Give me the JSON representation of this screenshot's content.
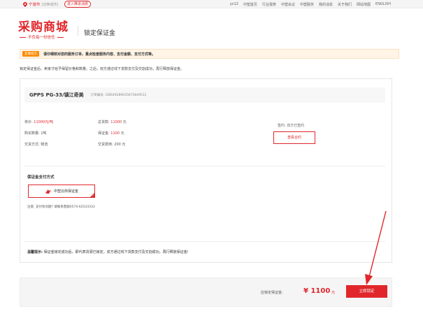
{
  "topbar": {
    "city": "宁波市",
    "switch_city": "[切换城市]",
    "login_label": "进入推进消费",
    "nav": [
      "yc12",
      "中塑首页",
      "行业报表",
      "中塑会议",
      "中塑服务",
      "我的消息",
      "关于我们",
      "网站地图",
      "ENGLISH"
    ]
  },
  "header": {
    "logo_main": "采购商城",
    "logo_sub": "不负每一份信任",
    "page_title": "锁定保证金"
  },
  "notice": {
    "tag": "友情提示",
    "text": "请仔细核对您的服务订单，重点检查服务内容、支付金额、支付方式等。"
  },
  "intro": "锁定保证金后，卖家才给予保留价格和数量。之后，双方通过线下货款支付及交割成功，再行释放保证金。",
  "product": {
    "name": "GPPS PG-33/镇江奇美",
    "order_label": "订单编号:",
    "order_no": "DD649289035675849512"
  },
  "details": {
    "unit_price_label": "单价:",
    "unit_price": "11000元/吨",
    "qty_label": "购买数量:",
    "qty": "1吨",
    "delivery_label": "交货方式:",
    "delivery": "物流",
    "total_label": "总货款:",
    "total": "11000",
    "total_unit": "元",
    "deposit_label": "保证金:",
    "deposit": "1100",
    "deposit_unit": "元",
    "fee_label": "交货费用:",
    "fee": "200 元",
    "sign_status": "签约: 双方已签约",
    "view_contract": "查看合约"
  },
  "payment": {
    "title": "保证金支付方式",
    "option": "中塑云商保证金",
    "note": "注意: 支付有问题? 请联系客服0574-62533333"
  },
  "warm_tip": {
    "label": "温馨提示:",
    "text": "保证金锁定成功后，即代表货源已锁定，双方通过线下货款支付及交割成功，再行释放保证金!"
  },
  "footer": {
    "amount_label": "应锁定保证金:",
    "amount": "¥ 1100",
    "unit": "元",
    "lock_button": "立即锁定"
  },
  "colors": {
    "brand_red": "#e0262b",
    "notice_orange": "#ff8a00"
  }
}
